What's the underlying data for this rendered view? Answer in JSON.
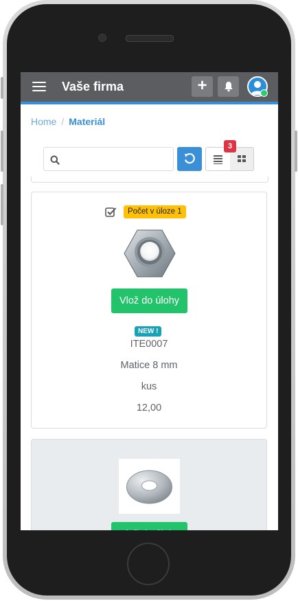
{
  "app": {
    "brand": "Vaše firma"
  },
  "breadcrumb": {
    "home": "Home",
    "separator": "/",
    "current": "Materiál"
  },
  "search": {
    "placeholder": ""
  },
  "view": {
    "badge_count": "3"
  },
  "products": [
    {
      "quantity_badge": "Počet v úloze 1",
      "add_label": "Vlož do úlohy",
      "new_badge": "NEW !",
      "code": "ITE0007",
      "name": "Matice 8 mm",
      "unit": "kus",
      "price": "12,00",
      "image": "hex-nut"
    },
    {
      "add_label": "Vlož do úlohy",
      "image": "flat-washer"
    }
  ],
  "colors": {
    "topbar": "#5b5d61",
    "accent": "#3a8fd6",
    "success": "#22c36b",
    "warning": "#ffc107",
    "danger": "#dc3545",
    "info": "#17a2b8"
  }
}
